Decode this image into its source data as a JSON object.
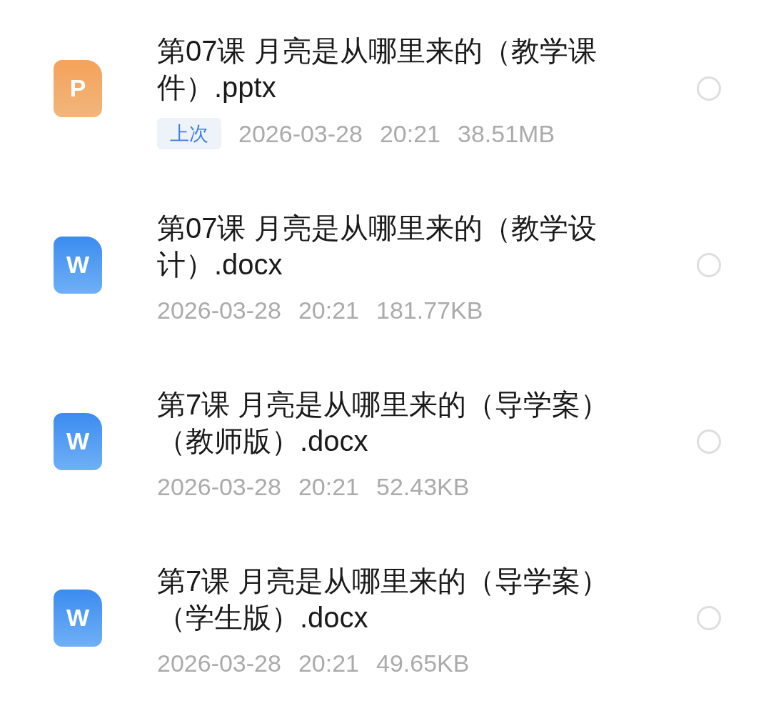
{
  "files": [
    {
      "kind": "pptx",
      "icon_letter": "P",
      "title": "第07课 月亮是从哪里来的（教学课件）.pptx",
      "badge": "上次",
      "date": "2026-03-28",
      "time": "20:21",
      "size": "38.51MB",
      "selected": false
    },
    {
      "kind": "docx",
      "icon_letter": "W",
      "title": "第07课 月亮是从哪里来的（教学设计）.docx",
      "date": "2026-03-28",
      "time": "20:21",
      "size": "181.77KB",
      "selected": false
    },
    {
      "kind": "docx",
      "icon_letter": "W",
      "title": "第7课 月亮是从哪里来的（导学案）（教师版）.docx",
      "date": "2026-03-28",
      "time": "20:21",
      "size": "52.43KB",
      "selected": false
    },
    {
      "kind": "docx",
      "icon_letter": "W",
      "title": "第7课 月亮是从哪里来的（导学案）（学生版）.docx",
      "date": "2026-03-28",
      "time": "20:21",
      "size": "49.65KB",
      "selected": false
    }
  ]
}
